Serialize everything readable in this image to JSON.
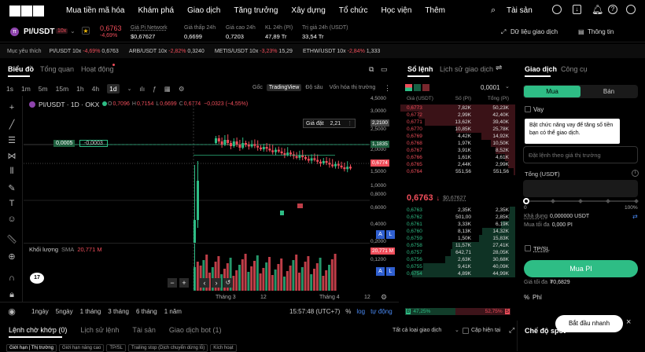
{
  "nav": {
    "items": [
      "Mua tiền mã hóa",
      "Khám phá",
      "Giao dịch",
      "Tăng trưởng",
      "Xây dựng",
      "Tổ chức",
      "Học viện",
      "Thêm"
    ],
    "assets": "Tài sản"
  },
  "ticker": {
    "pair": "PI/USDT",
    "leverage": "10x",
    "price": "0,6763",
    "change": "-4,69%",
    "network_label": "Giá Pi Network",
    "network_value": "$0,67627",
    "low_label": "Giá thấp 24h",
    "low_value": "0,6699",
    "high_label": "Giá cao 24h",
    "high_value": "0,7203",
    "vol_label": "KL 24h (PI)",
    "vol_value": "47,89 Tr",
    "val_label": "Trị giá 24h (USDT)",
    "val_value": "33,54 Tr",
    "data_link": "Dữ liệu giao dịch",
    "info_link": "Thông tin"
  },
  "watch": {
    "label": "Mục yêu thích",
    "items": [
      {
        "name": "PI/USDT 10x",
        "chg": "-4,69%",
        "px": "0,6763"
      },
      {
        "name": "ARB/USDT 10x",
        "chg": "-2,82%",
        "px": "0,3240"
      },
      {
        "name": "METIS/USDT 10x",
        "chg": "-3,23%",
        "px": "15,29"
      },
      {
        "name": "ETHW/USDT 10x",
        "chg": "-2,84%",
        "px": "1,333"
      }
    ]
  },
  "chart": {
    "tabs": [
      "Biểu đồ",
      "Tổng quan",
      "Hoạt động"
    ],
    "intervals": [
      "1s",
      "1m",
      "5m",
      "15m",
      "1h",
      "4h",
      "1d"
    ],
    "active_interval": "1d",
    "views": [
      "Gốc",
      "TradingView",
      "Độ sâu",
      "Vốn hóa thị trường"
    ],
    "legend_pair": "PI/USDT · 1D · OKX",
    "legend_o": "0,7096",
    "legend_h": "0,7154",
    "legend_l": "0,6699",
    "legend_c": "0,6774",
    "legend_chg": "−0,0323 (−4,55%)",
    "price_axis": [
      "4,5000",
      "3,0000",
      "2,5000",
      "2,0000",
      "1,5000",
      "1,0000",
      "0,8000",
      "0,6000",
      "0,4000",
      "0,2000",
      "0,1200"
    ],
    "tag_high": "2,2100",
    "tag_mid": "1,1835",
    "tag_last": "0,6774",
    "tag_vol": "20,771 M",
    "bid_chip": "0,0005",
    "ask_chip": "-0,0003",
    "set_price_label": "Giá đặt",
    "set_price_value": "2,21",
    "volume_label": "Khối lượng",
    "volume_sma": "SMA",
    "volume_value": "20,771 M",
    "x_labels": [
      "Tháng 3",
      "12",
      "Tháng 4",
      "12"
    ],
    "ranges": [
      "1ngày",
      "5ngày",
      "1 tháng",
      "3 tháng",
      "6 tháng",
      "1 năm"
    ],
    "time": "15:57:48 (UTC+7)",
    "pct": "%",
    "log": "log",
    "auto": "tự động",
    "tv_logo": "17",
    "axis_btn_a": "A",
    "axis_btn_l": "L"
  },
  "orderbook": {
    "tabs": [
      "Sổ lệnh",
      "Lịch sử giao dịch"
    ],
    "step": "0,0001",
    "headers": [
      "Giá (USDT)",
      "Số (PI)",
      "Tổng (PI)"
    ],
    "asks": [
      [
        "0,6773",
        "7,82K",
        "50,23K"
      ],
      [
        "0,6772",
        "2,99K",
        "42,40K"
      ],
      [
        "0,6771",
        "13,62K",
        "39,40K"
      ],
      [
        "0,6770",
        "10,85K",
        "25,78K"
      ],
      [
        "0,6769",
        "4,42K",
        "14,92K"
      ],
      [
        "0,6768",
        "1,97K",
        "10,50K"
      ],
      [
        "0,6767",
        "3,91K",
        "8,52K"
      ],
      [
        "0,6766",
        "1,61K",
        "4,61K"
      ],
      [
        "0,6765",
        "2,44K",
        "2,99K"
      ],
      [
        "0,6764",
        "551,56",
        "551,56"
      ]
    ],
    "mid": "0,6763",
    "mid_usd": "$0,67627",
    "bids": [
      [
        "0,6763",
        "2,35K",
        "2,35K"
      ],
      [
        "0,6762",
        "501,00",
        "2,85K"
      ],
      [
        "0,6761",
        "3,33K",
        "6,19K"
      ],
      [
        "0,6760",
        "8,13K",
        "14,32K"
      ],
      [
        "0,6759",
        "1,50K",
        "15,83K"
      ],
      [
        "0,6758",
        "11,57K",
        "27,41K"
      ],
      [
        "0,6757",
        "642,71",
        "28,05K"
      ],
      [
        "0,6756",
        "2,63K",
        "30,68K"
      ],
      [
        "0,6755",
        "9,41K",
        "40,09K"
      ],
      [
        "0,6754",
        "4,89K",
        "44,99K"
      ]
    ],
    "buy_pct": "47,25%",
    "sell_pct": "52,75%",
    "buy_label": "B",
    "sell_label": "S"
  },
  "trade": {
    "tabs": [
      "Giao dịch",
      "Công cụ"
    ],
    "buy": "Mua",
    "sell": "Bán",
    "borrow": "Vay",
    "tooltip": "Bật chức năng vay để tăng số tiền bạn có thể giao dịch.",
    "price_placeholder": "Đặt lệnh theo giá thị trường",
    "total_label": "Tổng (USDT)",
    "slider_min": "0",
    "slider_max": "100%",
    "avail_label": "Khả dụng",
    "avail_value": "0,000000 USDT",
    "max_buy_label": "Mua tối đa",
    "max_buy_value": "0,000 PI",
    "tpsl": "TP/SL",
    "buy_button": "Mua PI",
    "max_price_label": "Giá tối đa",
    "max_price_value": "₮0,6829",
    "fee": "Phí"
  },
  "bottom": {
    "tabs": [
      "Lệnh chờ khớp (0)",
      "Lịch sử lệnh",
      "Tài sản",
      "Giao dịch bot (1)"
    ],
    "filter": "Tất cả loại giao dịch",
    "hide_label": "Cặp hiện tại",
    "chips": [
      "Giới hạn | Thị trường",
      "Giới hạn nâng cao",
      "TP/SL",
      "Trailing stop (Dịch chuyển dừng lỗ)",
      "Kích hoạt"
    ],
    "right_title": "Chế độ spot",
    "quick_start": "Bắt đầu nhanh"
  },
  "colors": {
    "up": "#2ebd85",
    "down": "#ef4d5a",
    "accent": "#2ebd85"
  }
}
